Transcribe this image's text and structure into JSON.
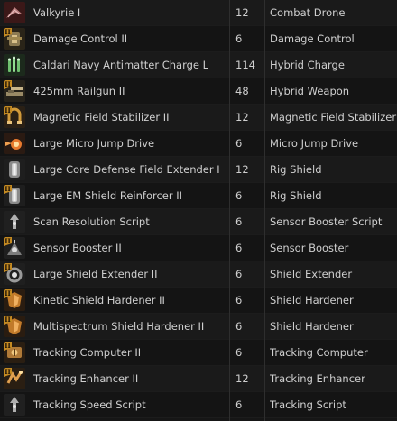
{
  "colors": {
    "text": "#cfcfcf",
    "row_odd": "#1a1a1a",
    "row_even": "#141414",
    "tech2_badge": "#c48a22"
  },
  "rows": [
    {
      "name": "Valkyrie I",
      "qty": "12",
      "group": "Combat Drone",
      "icon": "combat-drone-icon",
      "tech2": false
    },
    {
      "name": "Damage Control II",
      "qty": "6",
      "group": "Damage Control",
      "icon": "damage-control-icon",
      "tech2": true,
      "badge": "II"
    },
    {
      "name": "Caldari Navy Antimatter Charge L",
      "qty": "114",
      "group": "Hybrid Charge",
      "icon": "hybrid-charge-icon",
      "tech2": false
    },
    {
      "name": "425mm Railgun II",
      "qty": "48",
      "group": "Hybrid Weapon",
      "icon": "railgun-icon",
      "tech2": true,
      "badge": "II"
    },
    {
      "name": "Magnetic Field Stabilizer II",
      "qty": "12",
      "group": "Magnetic Field Stabilizer",
      "icon": "magnetic-field-stabilizer-icon",
      "tech2": true,
      "badge": "II"
    },
    {
      "name": "Large Micro Jump Drive",
      "qty": "6",
      "group": "Micro Jump Drive",
      "icon": "micro-jump-drive-icon",
      "tech2": false
    },
    {
      "name": "Large Core Defense Field Extender I",
      "qty": "12",
      "group": "Rig Shield",
      "icon": "shield-rig-icon",
      "tech2": false
    },
    {
      "name": "Large EM Shield Reinforcer II",
      "qty": "6",
      "group": "Rig Shield",
      "icon": "shield-rig-icon",
      "tech2": true,
      "badge": "II"
    },
    {
      "name": "Scan Resolution Script",
      "qty": "6",
      "group": "Sensor Booster Script",
      "icon": "script-icon",
      "tech2": false
    },
    {
      "name": "Sensor Booster II",
      "qty": "6",
      "group": "Sensor Booster",
      "icon": "sensor-booster-icon",
      "tech2": true,
      "badge": "II"
    },
    {
      "name": "Large Shield Extender II",
      "qty": "6",
      "group": "Shield Extender",
      "icon": "shield-extender-icon",
      "tech2": true,
      "badge": "II"
    },
    {
      "name": "Kinetic Shield Hardener II",
      "qty": "6",
      "group": "Shield Hardener",
      "icon": "shield-hardener-icon",
      "tech2": true,
      "badge": "II"
    },
    {
      "name": "Multispectrum Shield Hardener II",
      "qty": "6",
      "group": "Shield Hardener",
      "icon": "shield-hardener-icon",
      "tech2": true,
      "badge": "II"
    },
    {
      "name": "Tracking Computer II",
      "qty": "6",
      "group": "Tracking Computer",
      "icon": "tracking-computer-icon",
      "tech2": true,
      "badge": "II"
    },
    {
      "name": "Tracking Enhancer II",
      "qty": "12",
      "group": "Tracking Enhancer",
      "icon": "tracking-enhancer-icon",
      "tech2": true,
      "badge": "II"
    },
    {
      "name": "Tracking Speed Script",
      "qty": "6",
      "group": "Tracking Script",
      "icon": "script-icon",
      "tech2": false
    }
  ]
}
